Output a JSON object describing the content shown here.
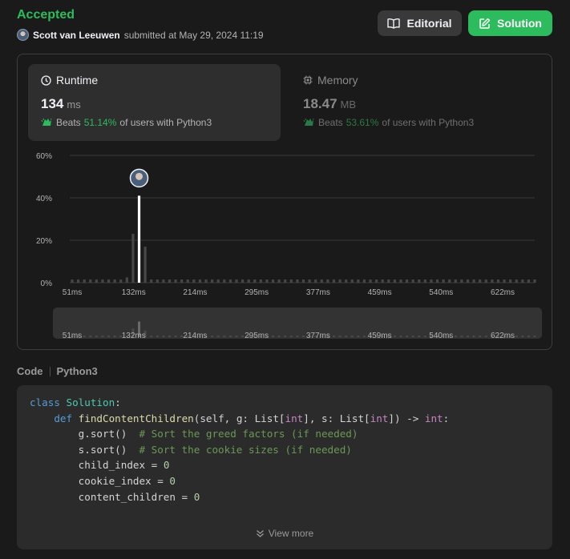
{
  "status": "Accepted",
  "submission": {
    "user": "Scott van Leeuwen",
    "submitted_text": "submitted at May 29, 2024 11:19"
  },
  "buttons": {
    "editorial_label": "Editorial",
    "solution_label": "Solution"
  },
  "runtime": {
    "title": "Runtime",
    "value": "134",
    "unit": "ms",
    "beats_label": "Beats",
    "beats_pct": "51.14%",
    "beats_suffix": "of users with Python3"
  },
  "memory": {
    "title": "Memory",
    "value": "18.47",
    "unit": "MB",
    "beats_label": "Beats",
    "beats_pct": "53.61%",
    "beats_suffix": "of users with Python3"
  },
  "chart_data": {
    "type": "bar",
    "title": "",
    "xlabel": "",
    "ylabel": "",
    "ylim": [
      0,
      60
    ],
    "y_ticks": [
      "60%",
      "40%",
      "20%",
      "0%"
    ],
    "x_ticks": [
      "51ms",
      "132ms",
      "214ms",
      "295ms",
      "377ms",
      "459ms",
      "540ms",
      "622ms"
    ],
    "grid": true,
    "highlight_index": 11,
    "values": [
      1.5,
      1.5,
      1.5,
      1.5,
      1.5,
      1.5,
      1.5,
      1.5,
      1.5,
      2.5,
      23,
      41,
      17,
      1.5,
      1.5,
      1.5,
      1.5,
      1.5,
      1.5,
      1.5,
      1.5,
      1.5,
      1.5,
      1.5,
      1.5,
      1.5,
      1.5,
      1.5,
      1.5,
      1.5,
      1.5,
      1.5,
      1.5,
      1.5,
      1.5,
      1.5,
      1.5,
      1.5,
      1.5,
      1.5,
      1.5,
      1.5,
      1.5,
      1.5,
      1.5,
      1.5,
      1.5,
      1.5,
      1.5,
      1.5,
      1.5,
      1.5,
      1.5,
      1.5,
      1.5,
      1.5,
      1.5,
      1.5,
      1.5,
      1.5,
      1.5,
      1.5,
      1.5,
      1.5,
      1.5,
      1.5,
      1.5,
      1.5,
      1.5,
      1.5,
      1.5,
      1.5,
      1.5,
      1.5,
      1.5,
      1.5,
      1.5
    ],
    "colors": {
      "bar": "#474747",
      "highlight": "#ffffff",
      "grid": "#3a3a3a"
    }
  },
  "code_section": {
    "label": "Code",
    "language": "Python3",
    "view_more": "View more"
  },
  "code_lines": [
    [
      [
        "kw",
        "class"
      ],
      [
        "",
        "​ "
      ],
      [
        "cls",
        "Solution"
      ],
      [
        "",
        ":"
      ]
    ],
    [
      [
        "",
        "    "
      ],
      [
        "kw",
        "def"
      ],
      [
        "",
        " "
      ],
      [
        "fn",
        "findContentChildren"
      ],
      [
        "",
        "(self, g: List["
      ],
      [
        "ty",
        "int"
      ],
      [
        "",
        "], s: List["
      ],
      [
        "ty",
        "int"
      ],
      [
        "",
        "]) -> "
      ],
      [
        "ty",
        "int"
      ],
      [
        "",
        ":"
      ]
    ],
    [
      [
        "",
        "        g.sort()  "
      ],
      [
        "cm",
        "# Sort the greed factors (if needed)"
      ]
    ],
    [
      [
        "",
        "        s.sort()  "
      ],
      [
        "cm",
        "# Sort the cookie sizes (if needed)"
      ]
    ],
    [
      [
        "",
        "        child_index = "
      ],
      [
        "num",
        "0"
      ]
    ],
    [
      [
        "",
        "        cookie_index = "
      ],
      [
        "num",
        "0"
      ]
    ],
    [
      [
        "",
        "        content_children = "
      ],
      [
        "num",
        "0"
      ]
    ]
  ]
}
